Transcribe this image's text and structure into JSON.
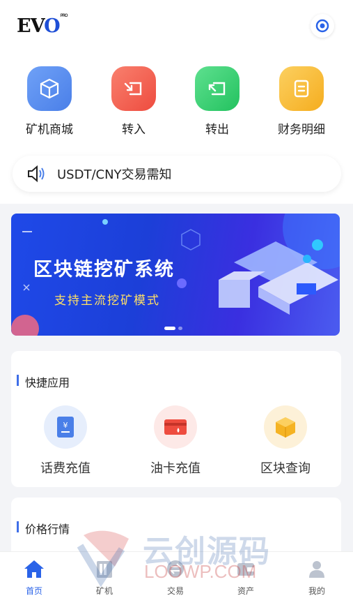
{
  "header": {
    "logo_text": "EVO",
    "logo_badge": "PRO"
  },
  "quick_actions": [
    {
      "label": "矿机商城",
      "icon": "cube-icon",
      "color": "#4f86f0"
    },
    {
      "label": "转入",
      "icon": "transfer-in-icon",
      "color": "#f0584a"
    },
    {
      "label": "转出",
      "icon": "transfer-out-icon",
      "color": "#2fcf6c"
    },
    {
      "label": "财务明细",
      "icon": "document-icon",
      "color": "#f7b52a"
    }
  ],
  "notice": {
    "text": "USDT/CNY交易需知"
  },
  "banner": {
    "title": "区块链挖矿系统",
    "subtitle": "支持主流挖矿模式"
  },
  "shortcuts": {
    "title": "快捷应用",
    "items": [
      {
        "label": "话费充值",
        "icon": "phone-recharge-icon"
      },
      {
        "label": "油卡充值",
        "icon": "fuel-card-icon"
      },
      {
        "label": "区块查询",
        "icon": "block-query-icon"
      }
    ]
  },
  "market": {
    "title": "价格行情"
  },
  "tabbar": [
    {
      "label": "首页",
      "icon": "home-icon",
      "active": true
    },
    {
      "label": "矿机",
      "icon": "miner-icon",
      "active": false
    },
    {
      "label": "交易",
      "icon": "trade-icon",
      "active": false
    },
    {
      "label": "资产",
      "icon": "wallet-icon",
      "active": false
    },
    {
      "label": "我的",
      "icon": "user-icon",
      "active": false
    }
  ],
  "watermark": {
    "text": "云创源码",
    "url": "LOOWP.COM"
  },
  "colors": {
    "accent": "#2a63e8",
    "banner_bg": "#1f49e8"
  }
}
